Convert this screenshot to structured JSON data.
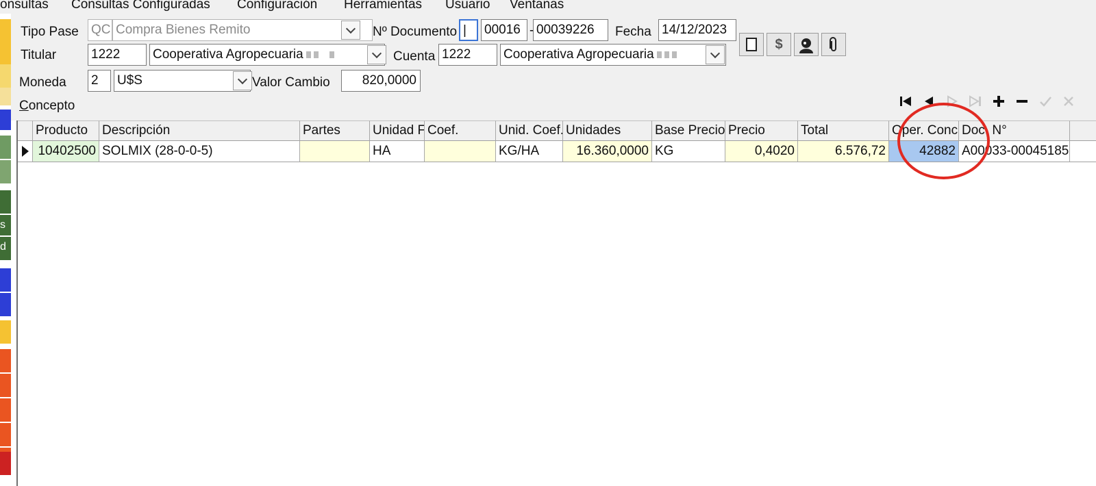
{
  "menu": [
    "onsultas",
    "Consultas Configuradas",
    "Configuración",
    "Herramientas",
    "Usuario",
    "Ventanas"
  ],
  "left_strip": {
    "swatch_colors": [
      "#f5c232",
      "#f5c232",
      "#f5d86e",
      "#f5e09a",
      "#2d3ed6",
      "#6f9b63",
      "#7fa570",
      "#3f6d35",
      "#3f6d35",
      "#3f6d35",
      "#2d3ed6",
      "#2d3ed6",
      "#f5c232",
      "#ea5521",
      "#ea5521",
      "#ea5521",
      "#ea5521",
      "#ea5521",
      "#cc2222"
    ],
    "glyph_s": "s",
    "glyph_d": "d"
  },
  "form": {
    "tipo_pase_label": "Tipo Pase",
    "tipo_pase_code": "QC",
    "tipo_pase_value": "Compra Bienes Remito",
    "nro_doc_label": "Nº Documento",
    "doc_letter": "|",
    "doc_branch": "00016",
    "doc_sep": "-",
    "doc_number": "00039226",
    "fecha_label": "Fecha",
    "fecha_value": "14/12/2023",
    "titular_label": "Titular",
    "titular_code": "1222",
    "titular_name": "Cooperativa Agropecuaria",
    "cuenta_label": "Cuenta",
    "cuenta_code": "1222",
    "cuenta_name": "Cooperativa Agropecuaria",
    "moneda_label": "Moneda",
    "moneda_code": "2",
    "moneda_value": "U$S",
    "valor_cambio_label": "Valor Cambio",
    "valor_cambio_value": "820,0000",
    "concepto_label_first": "C",
    "concepto_label_rest": "oncepto"
  },
  "toolbar": {
    "dollar": "$"
  },
  "grid": {
    "columns": [
      "Producto",
      "Descripción",
      "Partes",
      "Unidad F",
      "Coef.",
      "Unid. Coef.",
      "Unidades",
      "Base Precio",
      "Precio",
      "Total",
      "Oper. Conc",
      "Doc. N°"
    ],
    "rows": [
      [
        "10402500",
        "SOLMIX (28-0-0-5)",
        "",
        "HA",
        "",
        "KG/HA",
        "16.360,0000",
        "KG",
        "0,4020",
        "6.576,72",
        "42882",
        "A00033-00045185"
      ]
    ]
  },
  "colors": {
    "annotation": "#e12a22",
    "selected_cell": "#a8c8f0",
    "editable_cell": "#ffffdc",
    "product_cell": "#e2f6db"
  }
}
